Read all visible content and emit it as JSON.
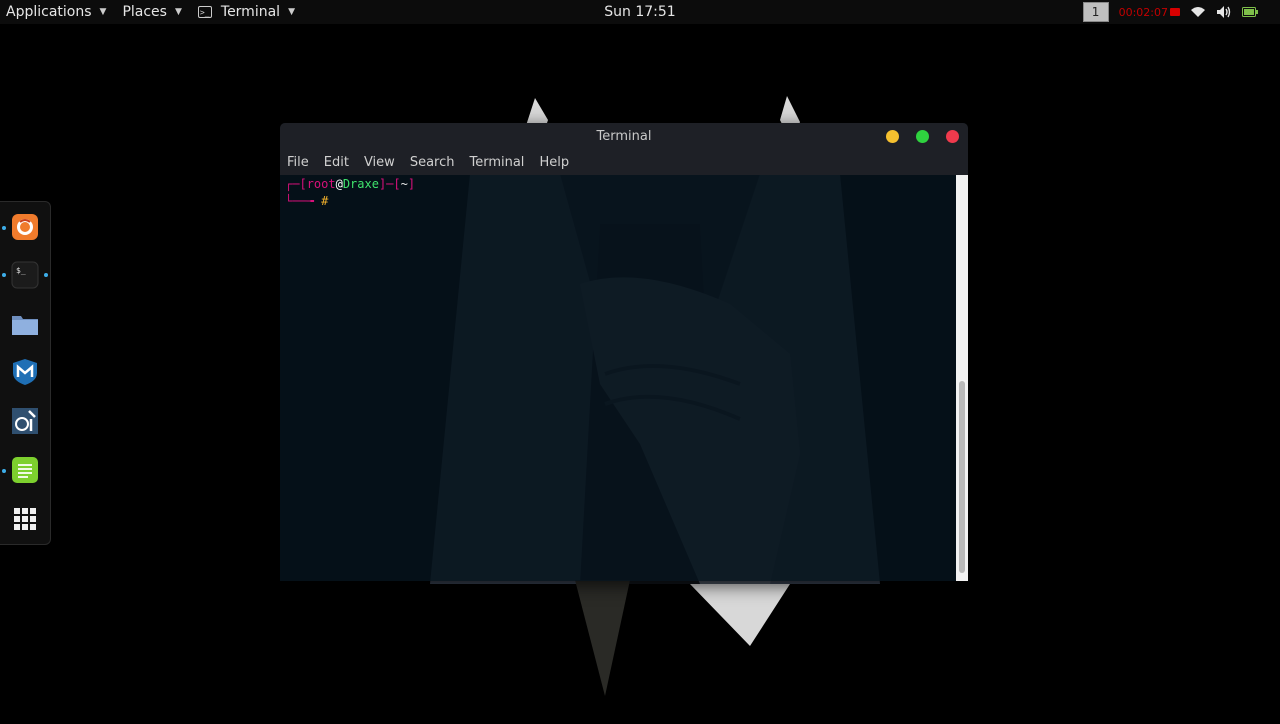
{
  "topbar": {
    "applications": "Applications",
    "places": "Places",
    "terminal_menu": "Terminal",
    "clock": "Sun 17:51",
    "workspace": "1",
    "recorder_time": "00:02:07"
  },
  "dock": {
    "items": [
      "firefox-icon",
      "terminal-icon",
      "files-icon",
      "metasploit-icon",
      "armitage-icon",
      "notes-icon",
      "app-grid-icon"
    ]
  },
  "window": {
    "title": "Terminal",
    "menu": [
      "File",
      "Edit",
      "View",
      "Search",
      "Terminal",
      "Help"
    ],
    "prompt": {
      "user": "root",
      "at": "@",
      "host": "Draxe",
      "dir": "~",
      "symbol": "#"
    }
  },
  "colors": {
    "prompt_bracket": "#d7107a",
    "prompt_host": "#3fe36c",
    "prompt_symbol": "#f2b12b",
    "minimize": "#f5c02f",
    "maximize": "#2fd23f",
    "close": "#f03a4d"
  }
}
